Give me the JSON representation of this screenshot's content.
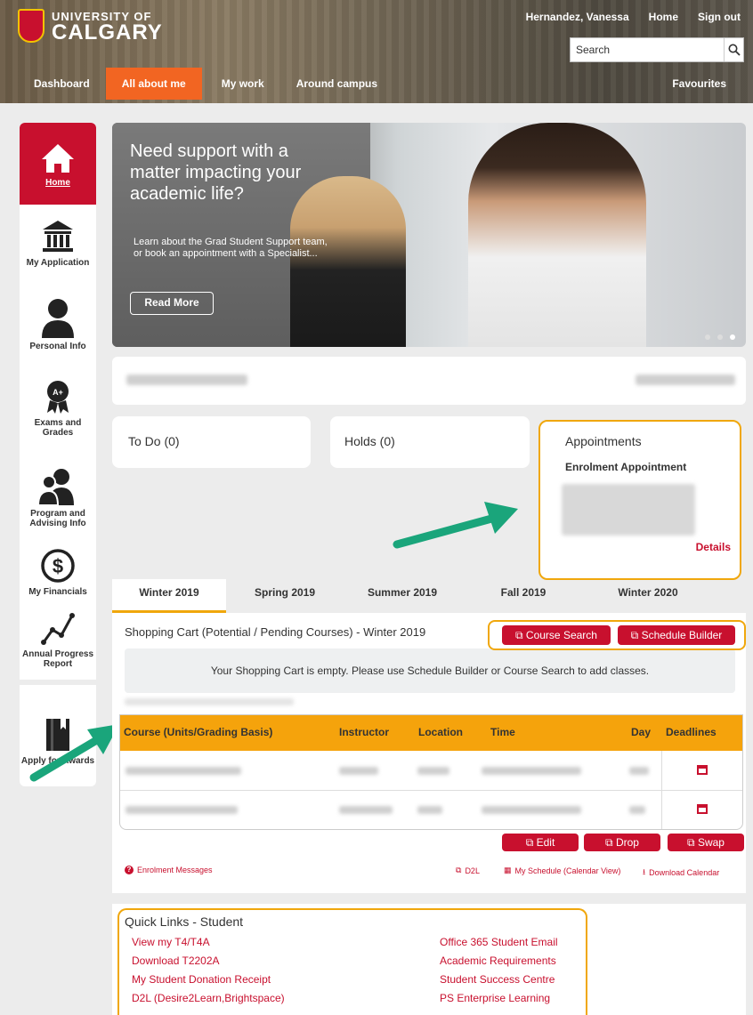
{
  "header": {
    "logo_line1": "UNIVERSITY OF",
    "logo_line2": "CALGARY",
    "user_name": "Hernandez, Vanessa",
    "home_link": "Home",
    "signout_link": "Sign out",
    "search_placeholder": "Search"
  },
  "nav": {
    "items": [
      "Dashboard",
      "All about me",
      "My work",
      "Around campus"
    ],
    "active": "All about me",
    "favourites": "Favourites"
  },
  "sidebar": {
    "items": [
      {
        "label": "Home",
        "icon": "home-icon"
      },
      {
        "label": "My Application",
        "icon": "institution-icon"
      },
      {
        "label": "Personal Info",
        "icon": "person-icon"
      },
      {
        "label": "Exams and Grades",
        "icon": "award-icon"
      },
      {
        "label": "Program and Advising Info",
        "icon": "advising-icon"
      },
      {
        "label": "My Financials",
        "icon": "dollar-icon"
      },
      {
        "label": "Annual Progress Report",
        "icon": "progress-chart-icon"
      },
      {
        "label": "Apply for Awards",
        "icon": "book-icon"
      }
    ]
  },
  "hero": {
    "title": "Need support with a matter impacting your academic life?",
    "subtitle": "Learn about the Grad Student Support team, or book an appointment with a Specialist...",
    "button": "Read More"
  },
  "cards": {
    "todo": "To Do (0)",
    "holds": "Holds (0)",
    "appointments_title": "Appointments",
    "enrolment_appointment": "Enrolment Appointment",
    "details": "Details"
  },
  "terms": {
    "tabs": [
      "Winter 2019",
      "Spring 2019",
      "Summer 2019",
      "Fall 2019",
      "Winter 2020"
    ],
    "active": "Winter 2019"
  },
  "cart": {
    "title": "Shopping Cart (Potential / Pending Courses) - Winter 2019",
    "course_search": "Course Search",
    "schedule_builder": "Schedule Builder",
    "empty_message": "Your Shopping Cart is empty. Please use Schedule Builder or Course Search to add classes."
  },
  "enrolled_table": {
    "headers": [
      "Course (Units/Grading Basis)",
      "Instructor",
      "Location",
      "Time",
      "Day",
      "Deadlines"
    ],
    "actions": [
      "Edit",
      "Drop",
      "Swap"
    ]
  },
  "footer_links": {
    "enrolment_messages": "Enrolment Messages",
    "d2l": "D2L",
    "my_schedule": "My Schedule (Calendar View)",
    "download_calendar": "Download Calendar"
  },
  "quick_links": {
    "title": "Quick Links - Student",
    "left": [
      "View my T4/T4A",
      "Download T2202A",
      "My Student Donation Receipt",
      "D2L (Desire2Learn,Brightspace)"
    ],
    "right": [
      "Office 365 Student Email",
      "Academic Requirements",
      "Student Success Centre",
      "PS Enterprise Learning"
    ]
  },
  "colors": {
    "brand_red": "#c8102e",
    "nav_active": "#f26522",
    "highlight_orange": "#f0a70c",
    "table_header": "#f5a30c",
    "arrow_green": "#1aa57b"
  }
}
